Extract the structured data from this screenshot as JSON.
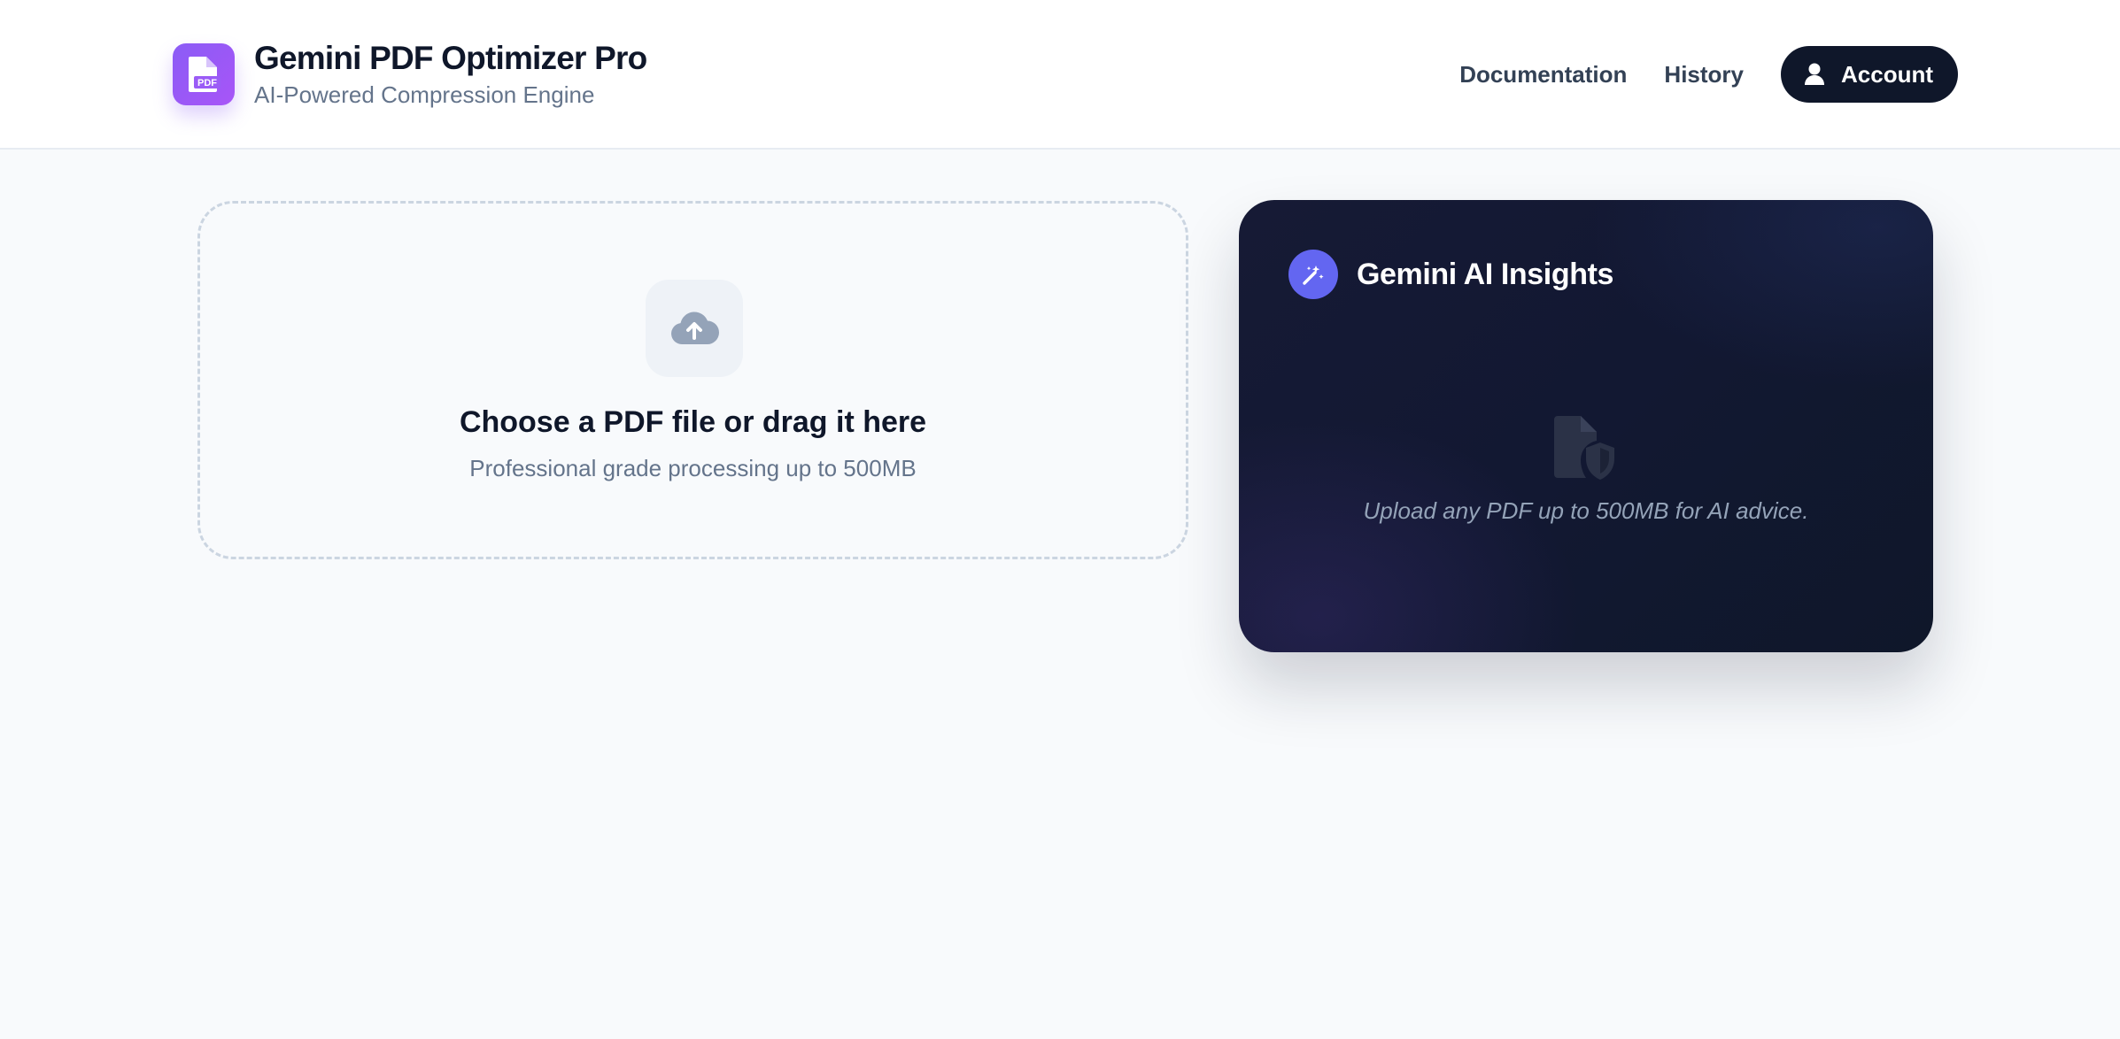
{
  "header": {
    "app_title": "Gemini PDF Optimizer Pro",
    "app_subtitle": "AI-Powered Compression Engine",
    "logo_icon": "pdf-file-icon",
    "logo_text": "PDF",
    "nav": [
      {
        "label": "Documentation"
      },
      {
        "label": "History"
      }
    ],
    "account_label": "Account",
    "account_icon": "user-icon"
  },
  "upload": {
    "icon": "cloud-upload-icon",
    "title": "Choose a PDF file or drag it here",
    "subtitle": "Professional grade processing up to 500MB"
  },
  "insights": {
    "icon": "magic-wand-icon",
    "title": "Gemini AI Insights",
    "empty_icon": "file-shield-icon",
    "message": "Upload any PDF up to 500MB for AI advice."
  },
  "colors": {
    "brand_gradient_start": "#8b5cf6",
    "brand_gradient_end": "#a855f7",
    "dark": "#0f172a",
    "accent_indigo": "#6366f1",
    "muted_text": "#64748b"
  }
}
